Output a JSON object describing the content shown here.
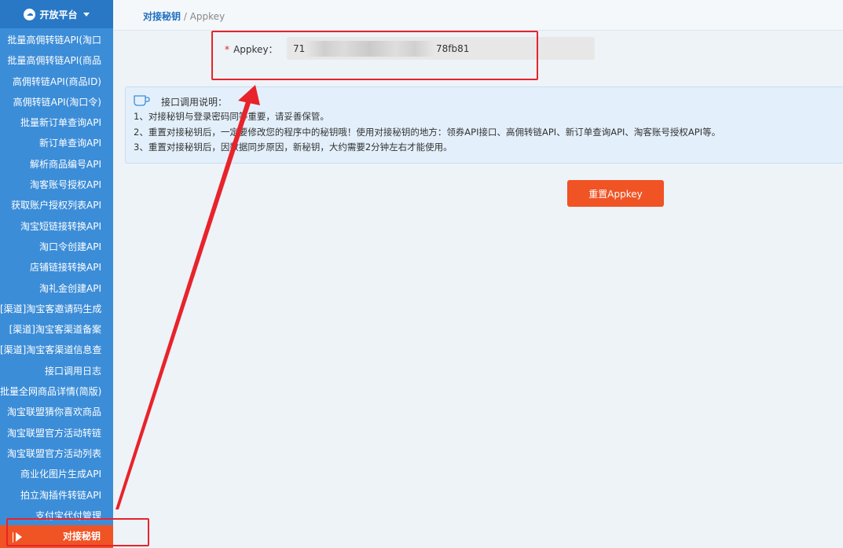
{
  "sidebar": {
    "header_label": "开放平台",
    "items": [
      "批量高佣转链API(淘口",
      "批量高佣转链API(商品",
      "高佣转链API(商品ID)",
      "高佣转链API(淘口令)",
      "批量新订单查询API",
      "新订单查询API",
      "解析商品编号API",
      "淘客账号授权API",
      "获取账户授权列表API",
      "淘宝短链接转换API",
      "淘口令创建API",
      "店铺链接转换API",
      "淘礼金创建API",
      "[渠道]淘宝客邀请码生成",
      "[渠道]淘宝客渠道备案",
      "[渠道]淘宝客渠道信息查",
      "接口调用日志",
      "批量全网商品详情(简版)",
      "淘宝联盟猜你喜欢商品",
      "淘宝联盟官方活动转链",
      "淘宝联盟官方活动列表",
      "商业化图片生成API",
      "拍立淘插件转链API",
      "支付宝代付管理"
    ],
    "active_item": "对接秘钥"
  },
  "breadcrumb": {
    "parent": "对接秘钥",
    "separator": "/",
    "current": "Appkey"
  },
  "form": {
    "required_mark": "*",
    "label": "Appkey：",
    "value_start": "713a",
    "value_end": "78fb81"
  },
  "notice": {
    "title": "接口调用说明：",
    "lines": [
      "1、对接秘钥与登录密码同等重要，请妥善保管。",
      "2、重置对接秘钥后，一定要修改您的程序中的秘钥哦！使用对接秘钥的地方：领券API接口、高佣转链API、新订单查询API、淘客账号授权API等。",
      "3、重置对接秘钥后，因数据同步原因，新秘钥，大约需要2分钟左右才能使用。"
    ]
  },
  "actions": {
    "reset_label": "重置Appkey"
  },
  "colors": {
    "sidebar_bg": "#3c8dd8",
    "accent": "#f05324",
    "annotation": "#e8232b"
  }
}
